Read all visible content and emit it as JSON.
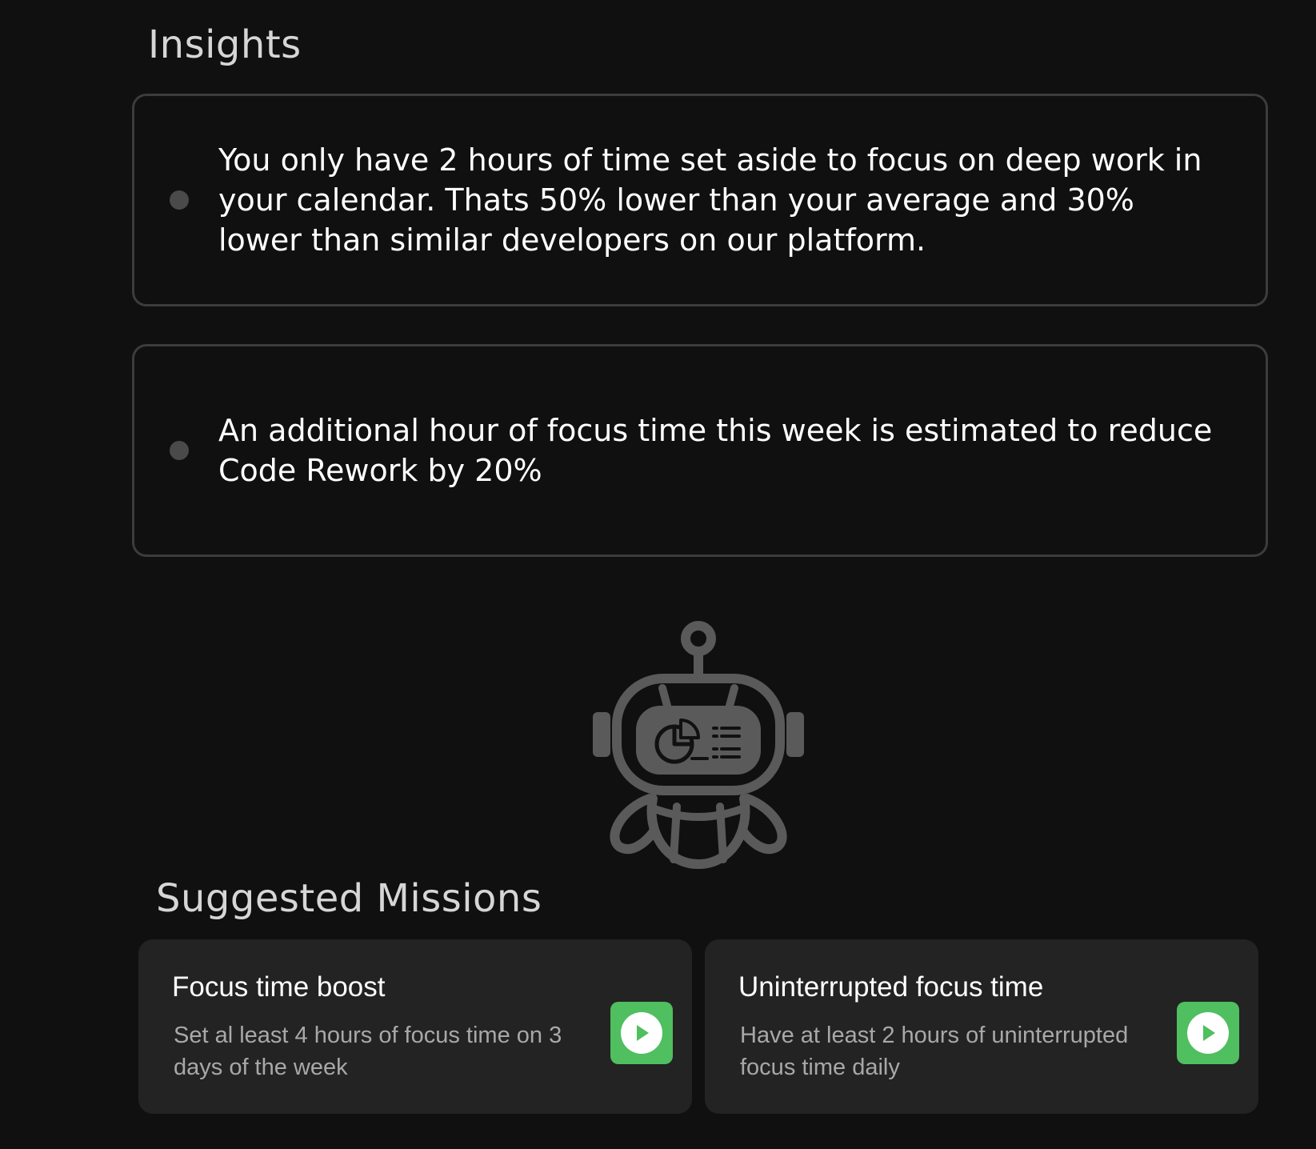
{
  "insights": {
    "title": "Insights",
    "items": [
      {
        "text": "You only have 2 hours of time set aside to focus on deep work in your calendar. Thats 50% lower than your average and  30% lower than similar developers on our platform."
      },
      {
        "text": "An additional hour of focus time this week is estimated to reduce Code Rework by 20%"
      }
    ]
  },
  "robot": {
    "icon": "robot-analytics-icon"
  },
  "missions": {
    "title": "Suggested Missions",
    "items": [
      {
        "title": "Focus time boost",
        "description": "Set al least 4 hours of focus time on 3 days of the week",
        "action_icon": "play-icon"
      },
      {
        "title": "Uninterrupted focus time",
        "description": "Have at least 2 hours of uninterrupted focus time daily",
        "action_icon": "play-icon"
      }
    ]
  },
  "colors": {
    "background": "#101010",
    "card_border": "#3c3c3c",
    "mission_card": "#232323",
    "accent_green": "#4fbf5f"
  }
}
